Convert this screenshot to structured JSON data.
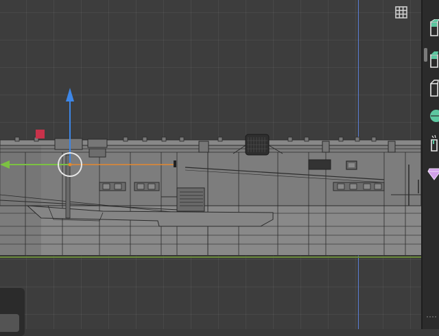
{
  "app": {
    "name": "3D viewport",
    "colors": {
      "background": "#3d3d3d",
      "grid": "#4a4a4a",
      "x_axis": "#7cc242",
      "z_axis": "#3d86e6",
      "y_axis_line": "#5b7fd8",
      "floor_line": "#6a8a3a",
      "handle_orange": "#e58a2e",
      "mesh_fill": "#7b7b7b",
      "wire": "#262626"
    }
  },
  "viewport": {
    "overlay_toggle_icon": "grid-icon"
  },
  "gizmo": {
    "z_arrow_icon": "arrow-up-icon",
    "x_arrow_icon": "arrow-left-icon",
    "center_icon": "circle-icon",
    "corner_marker_icon": "square-marker-icon"
  },
  "toolbar": {
    "items": [
      {
        "icon": "cube-add-icon"
      },
      {
        "icon": "cube-shrink-icon"
      },
      {
        "icon": "cube-extrude-icon"
      },
      {
        "icon": "shear-icon"
      },
      {
        "icon": "spin-icon"
      },
      {
        "icon": "gem-icon"
      }
    ]
  }
}
